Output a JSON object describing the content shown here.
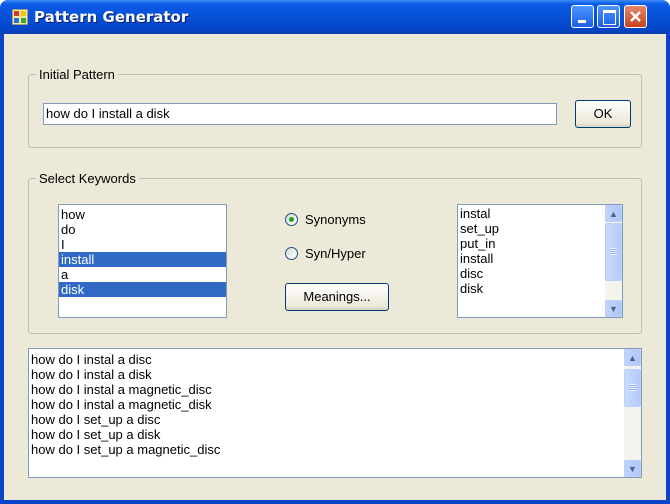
{
  "window": {
    "title": "Pattern Generator",
    "colors": {
      "titlebar": "#0650d8",
      "client": "#ece9d8",
      "selection": "#316ac5"
    }
  },
  "initial_pattern": {
    "legend": "Initial Pattern",
    "value": "how do I install a disk",
    "ok_label": "OK"
  },
  "select_keywords": {
    "legend": "Select Keywords",
    "words": [
      {
        "text": "how",
        "selected": false
      },
      {
        "text": "do",
        "selected": false
      },
      {
        "text": "I",
        "selected": false
      },
      {
        "text": "install",
        "selected": true
      },
      {
        "text": "a",
        "selected": false
      },
      {
        "text": "disk",
        "selected": true
      }
    ],
    "radio_synonyms": "Synonyms",
    "radio_synhyper": "Syn/Hyper",
    "selected_mode": "Synonyms",
    "meanings_label": "Meanings...",
    "synonyms": [
      "instal",
      "set_up",
      "put_in",
      "install",
      "disc",
      "disk"
    ]
  },
  "results": [
    "how do I instal a disc",
    "how do I instal a disk",
    "how do I instal a magnetic_disc",
    "how do I instal a magnetic_disk",
    "how do I set_up a disc",
    "how do I set_up a disk",
    "how do I set_up a magnetic_disc"
  ]
}
